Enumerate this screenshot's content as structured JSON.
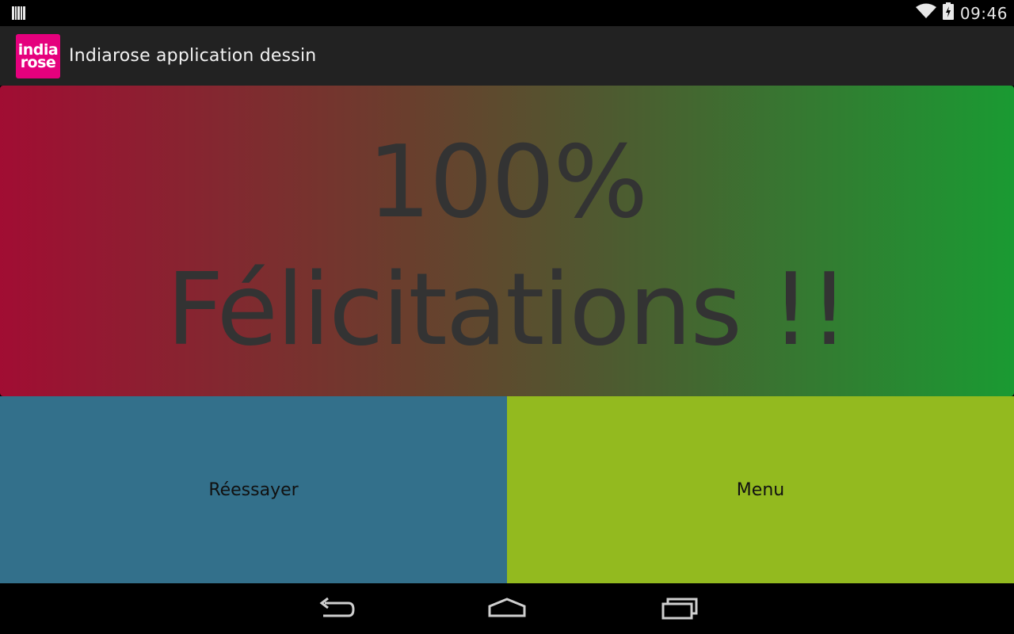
{
  "status_bar": {
    "time": "09:46",
    "icons": [
      "barcode-icon",
      "wifi-icon",
      "battery-icon"
    ]
  },
  "action_bar": {
    "logo_line1": "india",
    "logo_line2": "rose",
    "title": "Indiarose application dessin"
  },
  "result": {
    "score": "100%",
    "message": "Félicitations !!"
  },
  "buttons": {
    "retry_label": "Réessayer",
    "menu_label": "Menu"
  },
  "navigation": {
    "icons": [
      "back-icon",
      "home-icon",
      "recent-apps-icon"
    ]
  },
  "colors": {
    "logo": "#e5007d",
    "gradient_start": "#a10d33",
    "gradient_end": "#1a9a32",
    "retry_button": "#33708b",
    "menu_button": "#93ba1f",
    "action_bar": "#222222"
  }
}
